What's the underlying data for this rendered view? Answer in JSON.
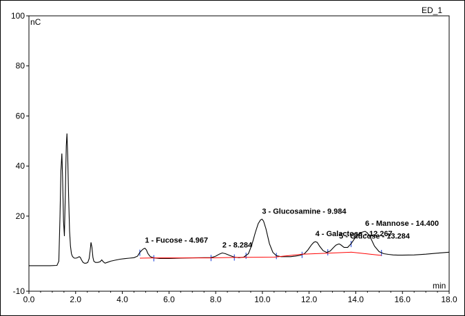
{
  "chart_data": {
    "type": "line",
    "title": "ED_1",
    "xlabel": "min",
    "ylabel": "nC",
    "xlim": [
      0.0,
      18.0
    ],
    "ylim": [
      -10,
      100
    ],
    "x_ticks": [
      "0.0",
      "2.0",
      "4.0",
      "6.0",
      "8.0",
      "10.0",
      "12.0",
      "14.0",
      "16.0",
      "18.0"
    ],
    "x_tick_values": [
      0,
      2,
      4,
      6,
      8,
      10,
      12,
      14,
      16,
      18
    ],
    "y_ticks": [
      "-10",
      "20",
      "40",
      "60",
      "80",
      "100"
    ],
    "y_tick_values": [
      -10,
      20,
      40,
      60,
      80,
      100
    ],
    "series": [
      {
        "color": "#000000",
        "x": [
          0.0,
          0.3,
          0.6,
          0.9,
          1.2,
          1.28,
          1.33,
          1.37,
          1.41,
          1.44,
          1.48,
          1.52,
          1.56,
          1.6,
          1.63,
          1.66,
          1.7,
          1.74,
          1.78,
          1.82,
          1.86,
          1.9,
          1.95,
          2.0,
          2.05,
          2.1,
          2.15,
          2.2,
          2.25,
          2.32,
          2.38,
          2.45,
          2.52,
          2.58,
          2.62,
          2.66,
          2.7,
          2.74,
          2.78,
          2.85,
          2.95,
          3.05,
          3.12,
          3.18,
          3.26,
          3.35,
          3.5,
          3.7,
          3.9,
          4.1,
          4.3,
          4.5,
          4.65,
          4.75,
          4.85,
          4.92,
          4.97,
          5.03,
          5.1,
          5.2,
          5.35,
          5.6,
          6.0,
          6.5,
          7.0,
          7.5,
          7.8,
          8.0,
          8.15,
          8.28,
          8.42,
          8.6,
          8.8,
          9.0,
          9.2,
          9.4,
          9.55,
          9.7,
          9.82,
          9.92,
          9.984,
          10.05,
          10.15,
          10.3,
          10.45,
          10.6,
          10.8,
          11.0,
          11.2,
          11.4,
          11.6,
          11.8,
          11.95,
          12.1,
          12.2,
          12.27,
          12.35,
          12.45,
          12.6,
          12.75,
          12.9,
          13.05,
          13.15,
          13.25,
          13.284,
          13.35,
          13.5,
          13.65,
          13.8,
          13.95,
          14.1,
          14.25,
          14.35,
          14.4,
          14.5,
          14.65,
          14.8,
          15.0,
          15.2,
          15.4,
          15.6,
          15.8,
          16.0,
          16.5,
          17.0,
          17.5,
          18.0
        ],
        "y": [
          0.2,
          0.2,
          0.2,
          0.2,
          0.3,
          2,
          20,
          38,
          45,
          36,
          18,
          12,
          30,
          48,
          53,
          44,
          28,
          14,
          8,
          5,
          4,
          3.5,
          3.2,
          3.2,
          3.3,
          3.5,
          3.8,
          3.5,
          2.5,
          1.5,
          1.2,
          1.2,
          1.5,
          3,
          6,
          9.5,
          7.5,
          3.5,
          2,
          1.5,
          1.5,
          1.8,
          2.5,
          1.8,
          1.2,
          1.5,
          2,
          2.4,
          2.8,
          3,
          3.2,
          3.4,
          4,
          5.5,
          6.5,
          7,
          7.2,
          6.5,
          5,
          3.8,
          3.3,
          3.1,
          3.1,
          3.2,
          3.3,
          3.4,
          3.4,
          4,
          4.8,
          5.3,
          5,
          4.3,
          3.6,
          3.4,
          3.6,
          5,
          8.5,
          13.5,
          17,
          18.5,
          18.8,
          18,
          15,
          9,
          5.5,
          4.2,
          3.8,
          3.8,
          3.8,
          4,
          4.3,
          5,
          6.5,
          8.5,
          9.5,
          9.8,
          9.5,
          8,
          6.2,
          5.5,
          6,
          7.5,
          8.4,
          8.8,
          8.9,
          8.6,
          7.5,
          7.5,
          9,
          11,
          12.5,
          13.5,
          13.8,
          13.9,
          13.3,
          11,
          8,
          5.8,
          5,
          4.7,
          4.5,
          4.4,
          4.4,
          4.5,
          4.8,
          5.2,
          5.6
        ]
      },
      {
        "color": "#ff0000",
        "x": [
          4.75,
          5.35,
          7.8,
          8.8,
          10.5,
          11.7,
          12.8,
          13.8,
          15.1
        ],
        "y": [
          3.2,
          3.3,
          3.3,
          3.5,
          3.6,
          4.8,
          5.2,
          5.6,
          4.3
        ]
      }
    ],
    "boundary_markers_x": [
      4.75,
      5.35,
      7.8,
      8.8,
      9.3,
      10.6,
      11.7,
      12.8,
      13.8,
      15.1
    ],
    "annotations": [
      {
        "text": "1 - Fucose - 4.967",
        "x": 4.967,
        "y": 7.2
      },
      {
        "text": "2 - 8.284",
        "x": 8.284,
        "y": 5.3
      },
      {
        "text": "3 - Glucosamine - 9.984",
        "x": 9.984,
        "y": 18.8
      },
      {
        "text": "4 - Galactose - 12.267",
        "x": 12.267,
        "y": 9.8
      },
      {
        "text": "5 - Glucose - 13.284",
        "x": 13.284,
        "y": 8.9
      },
      {
        "text": "6 - Mannose - 14.400",
        "x": 14.4,
        "y": 13.9
      }
    ]
  }
}
